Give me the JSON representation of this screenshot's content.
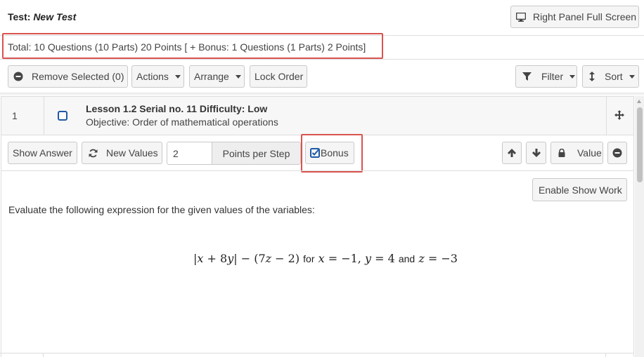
{
  "header": {
    "test_prefix": "Test:",
    "test_name": "New Test",
    "right_panel_button": "Right Panel Full Screen"
  },
  "summary": {
    "text": "Total: 10 Questions (10 Parts) 20 Points [ + Bonus: 1 Questions (1 Parts) 2 Points]"
  },
  "toolbar": {
    "remove_selected": "Remove Selected (0)",
    "actions": "Actions",
    "arrange": "Arrange",
    "lock_order": "Lock Order",
    "filter": "Filter",
    "sort": "Sort"
  },
  "question": {
    "number": "1",
    "title": "Lesson 1.2 Serial no. 11 Difficulty: Low",
    "objective": "Objective: Order of mathematical operations",
    "controls": {
      "show_answer": "Show Answer",
      "new_values": "New Values",
      "points_value": "2",
      "points_per_step": "Points per Step",
      "bonus": "Bonus",
      "bonus_checked": true,
      "value": "Value"
    },
    "enable_show_work": "Enable Show Work",
    "prompt": "Evaluate the following expression for the given values of the variables:",
    "expression": {
      "for_word": "for",
      "and_word": "and"
    }
  },
  "colors": {
    "highlight_border": "#d9534f",
    "checkbox_blue": "#1f5aa6",
    "button_bg": "#f5f5f5",
    "row_bg": "#f7f7f7"
  }
}
